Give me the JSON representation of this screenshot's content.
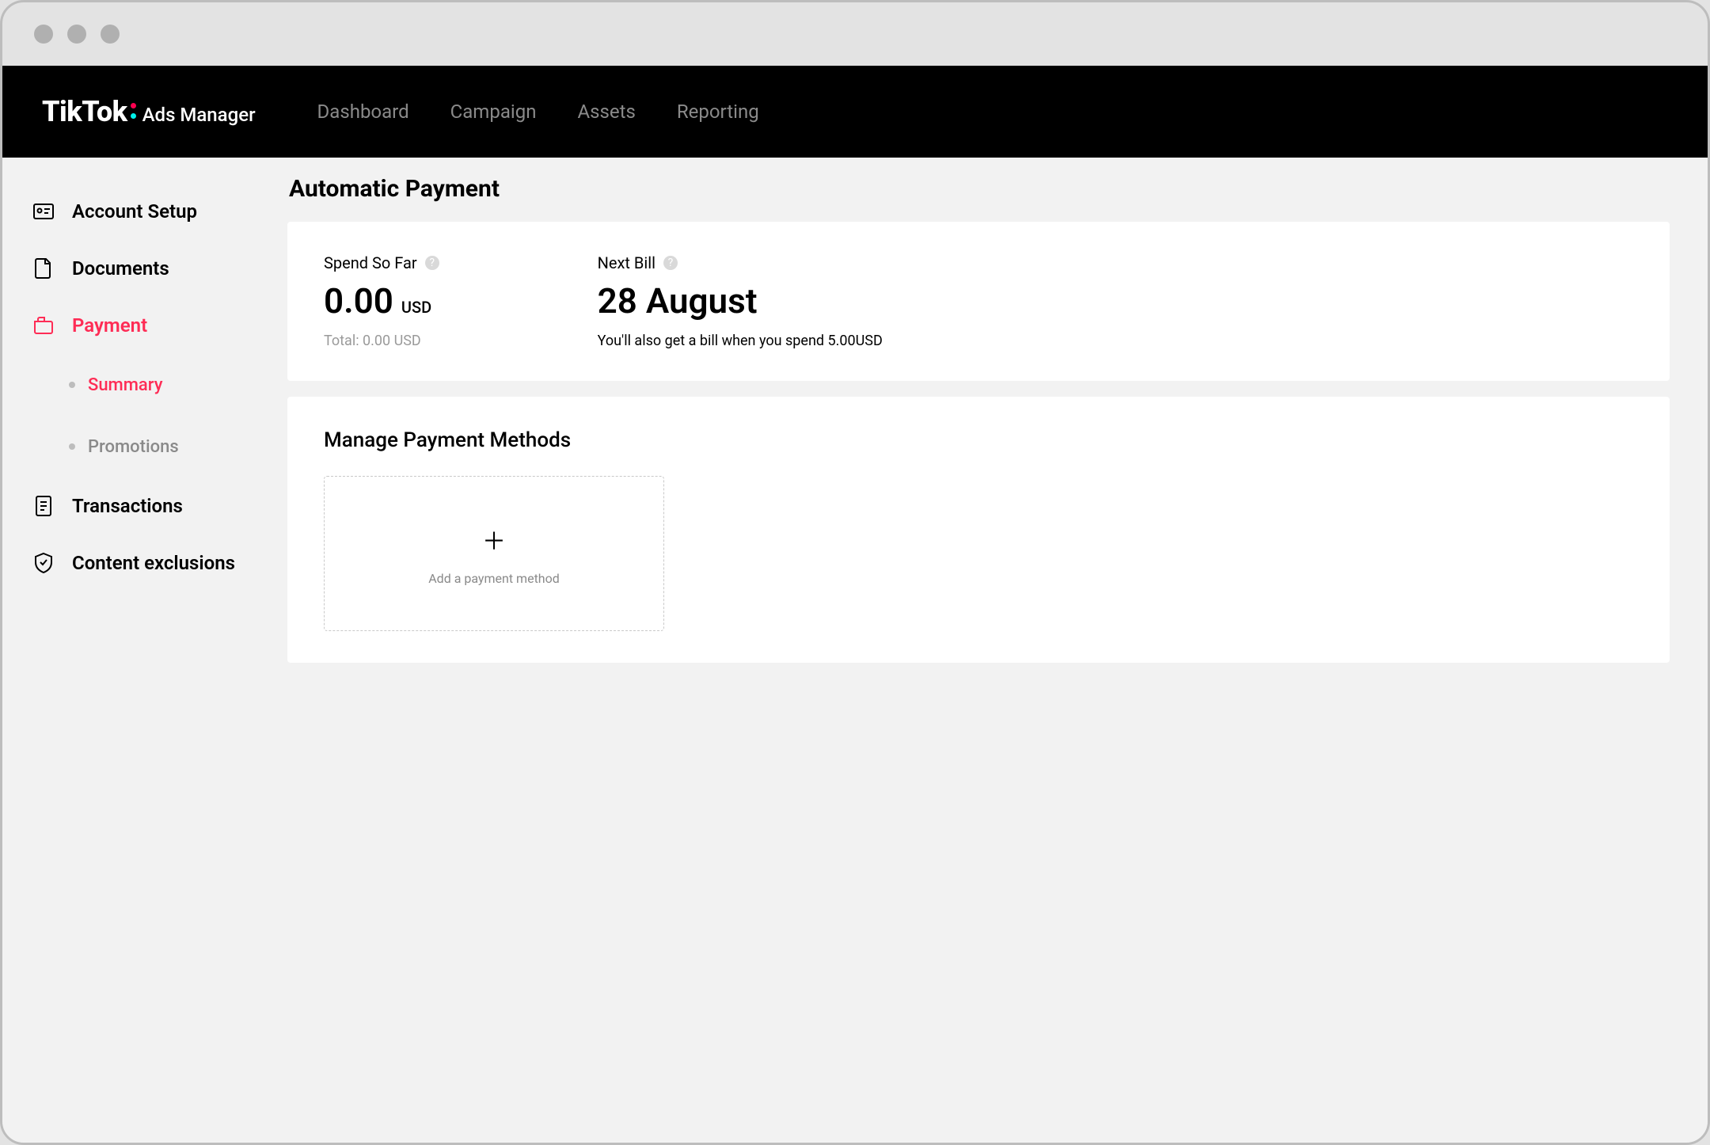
{
  "brand": {
    "name": "TikTok",
    "product": "Ads Manager"
  },
  "nav": {
    "dashboard": "Dashboard",
    "campaign": "Campaign",
    "assets": "Assets",
    "reporting": "Reporting"
  },
  "sidebar": {
    "account_setup": "Account Setup",
    "documents": "Documents",
    "payment": "Payment",
    "summary": "Summary",
    "promotions": "Promotions",
    "transactions": "Transactions",
    "content_exclusions": "Content exclusions"
  },
  "page": {
    "title": "Automatic Payment"
  },
  "spend": {
    "label": "Spend So Far",
    "amount": "0.00",
    "currency": "USD",
    "total": "Total: 0.00 USD"
  },
  "next_bill": {
    "label": "Next Bill",
    "date": "28 August",
    "note": "You'll also get a bill when you spend 5.00USD"
  },
  "methods": {
    "title": "Manage Payment Methods",
    "add_label": "Add a payment method"
  }
}
